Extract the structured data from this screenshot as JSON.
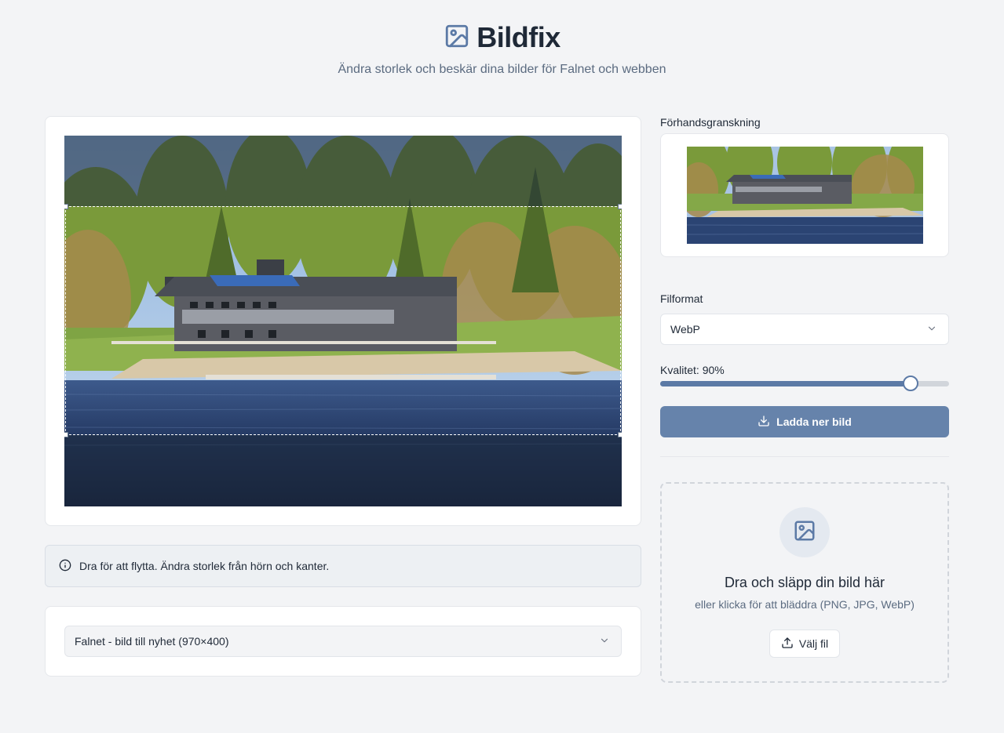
{
  "app": {
    "title": "Bildfix",
    "subtitle": "Ändra storlek och beskär dina bilder för Falnet och webben",
    "accent_color": "#5c7aa6",
    "icon": "image-icon"
  },
  "editor": {
    "hint": "Dra för att flytta. Ändra storlek från hörn och kanter.",
    "hint_icon": "info-icon",
    "preset_select": {
      "value": "Falnet - bild till nyhet (970×400)",
      "icon": "chevron-down-icon"
    }
  },
  "sidebar": {
    "preview_label": "Förhandsgranskning",
    "format_label": "Filformat",
    "format_value": "WebP",
    "quality_label": "Kvalitet: 90%",
    "quality_value": 0.9,
    "download_label": "Ladda ner bild",
    "download_icon": "download-icon"
  },
  "dropzone": {
    "title": "Dra och släpp din bild här",
    "subtitle": "eller klicka för att bläddra (PNG, JPG, WebP)",
    "button_label": "Välj fil",
    "button_icon": "upload-icon",
    "icon": "image-icon"
  }
}
